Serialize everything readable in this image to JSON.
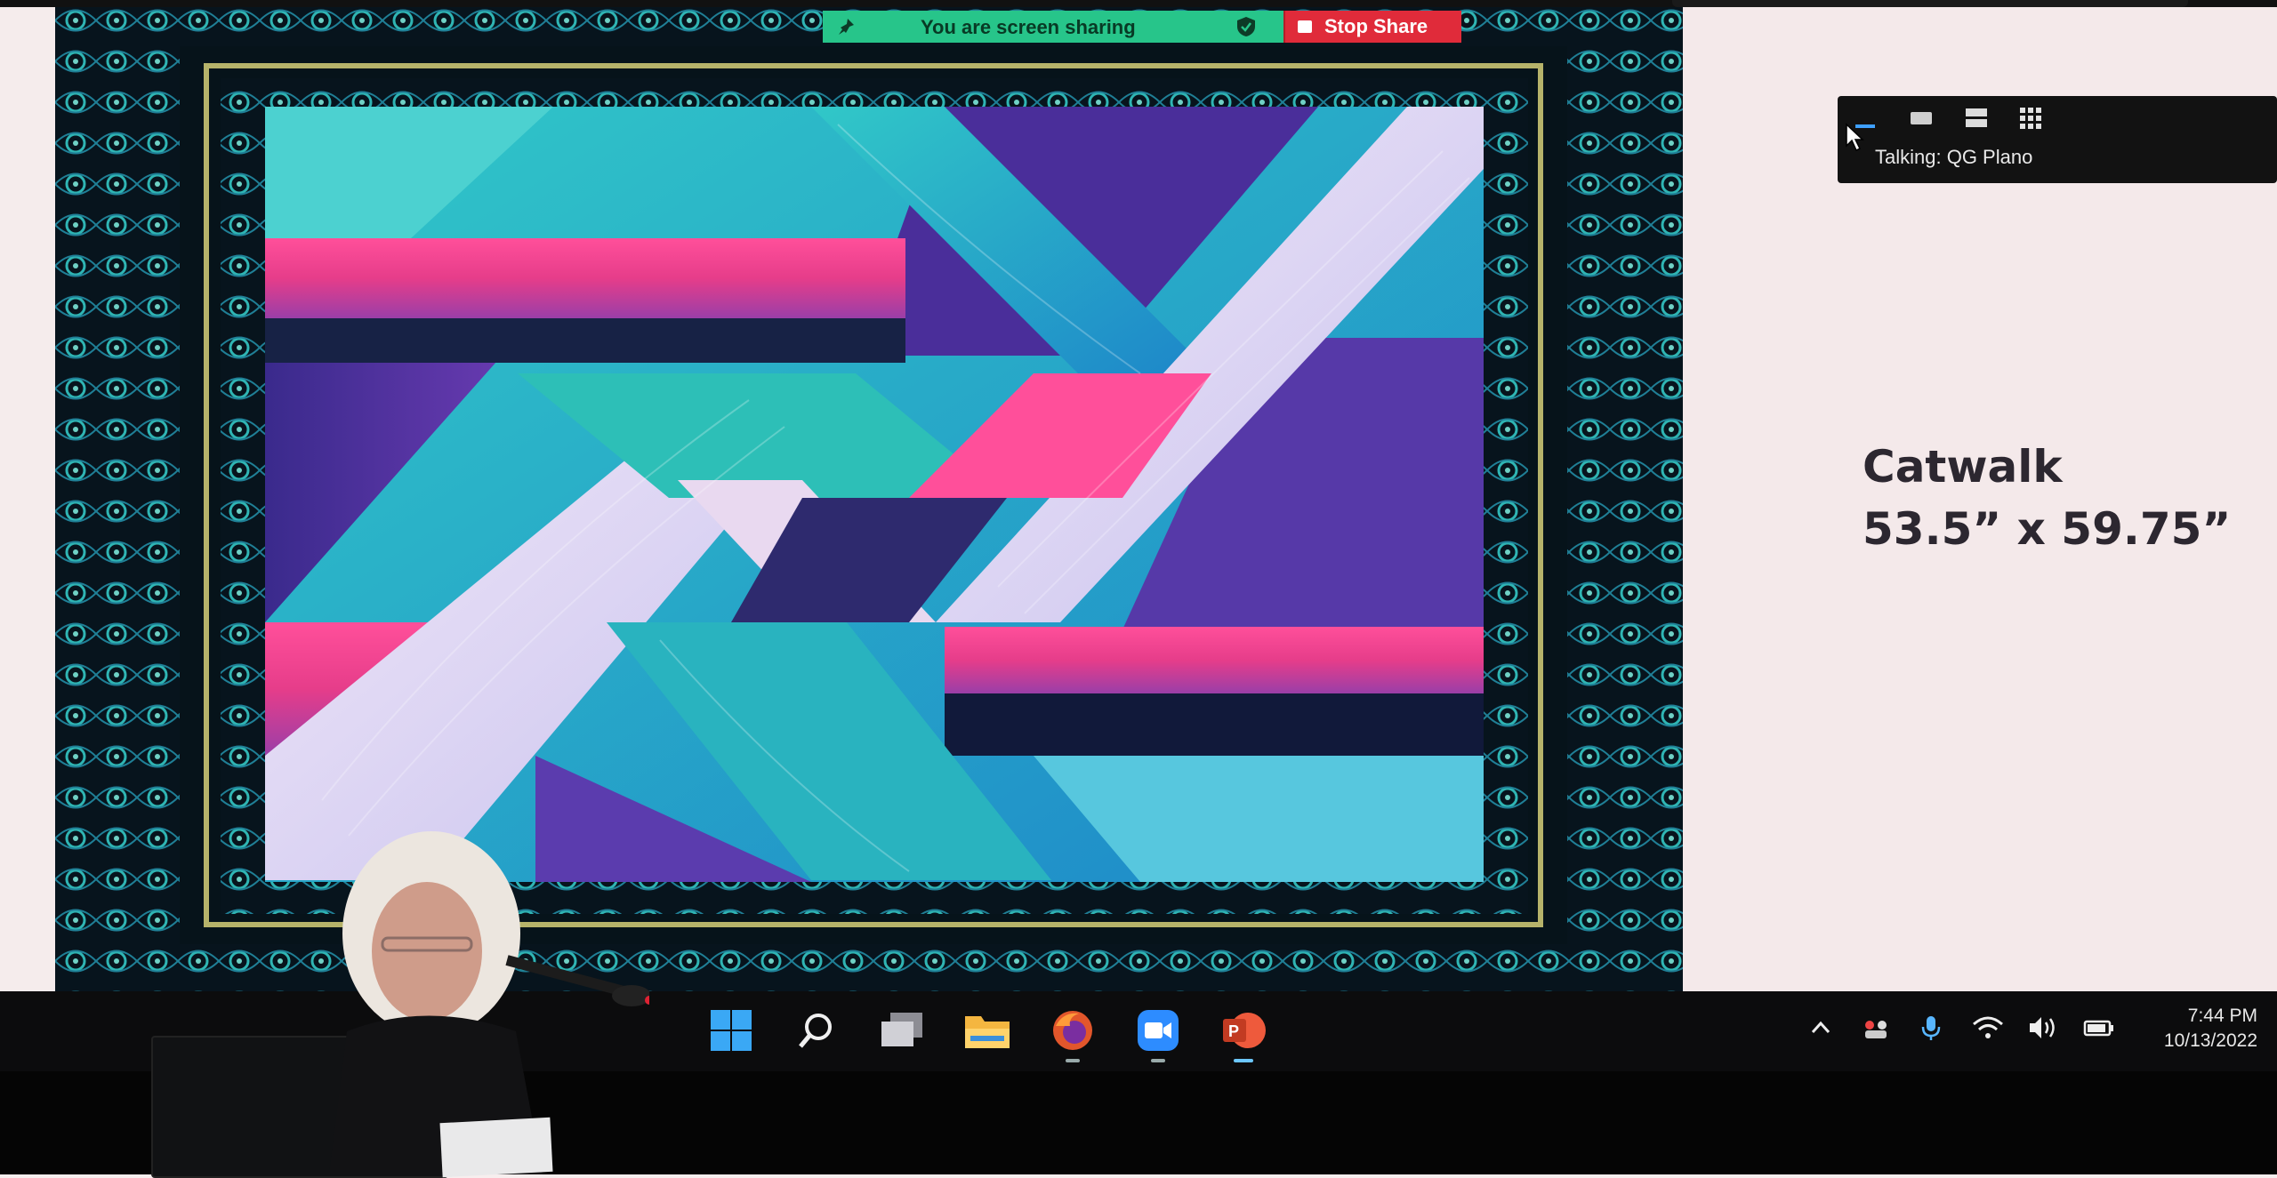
{
  "share_banner": {
    "message": "You are screen sharing",
    "stop_label": "Stop Share"
  },
  "zoom_panel": {
    "talking": "Talking: QG Plano",
    "view_icons": [
      "minimize-icon",
      "thumbnail-view-icon",
      "speaker-view-icon",
      "gallery-view-icon"
    ]
  },
  "slide": {
    "title": "Catwalk",
    "dimensions": "53.5” x 59.75”"
  },
  "taskbar": {
    "apps": [
      "windows-start-icon",
      "search-icon",
      "task-view-icon",
      "file-explorer-icon",
      "firefox-icon",
      "zoom-icon",
      "powerpoint-icon"
    ],
    "tray": [
      "chevron-up-icon",
      "meeting-indicator-icon",
      "microphone-icon",
      "wifi-icon",
      "volume-icon",
      "battery-icon"
    ],
    "time": "7:44 PM",
    "date": "10/13/2022"
  },
  "colors": {
    "share_green": "#27c58a",
    "stop_red": "#e02b3a",
    "slide_bg": "#f4e9ea",
    "taskbar_bg": "#0c0c0d"
  }
}
